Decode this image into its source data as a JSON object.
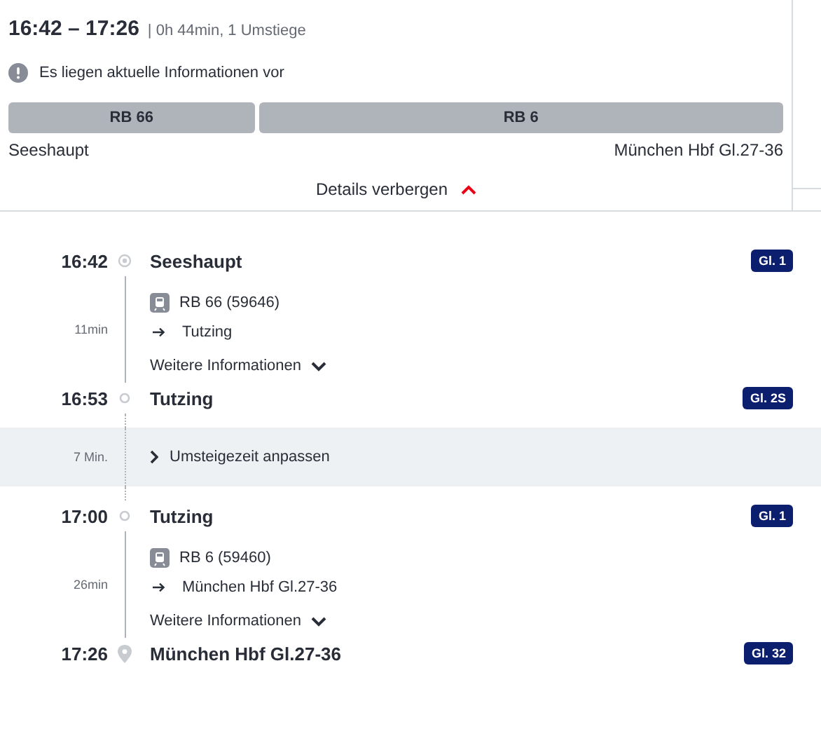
{
  "summary": {
    "times": "16:42 – 17:26",
    "meta": "| 0h 44min, 1 Umstiege",
    "notice": "Es liegen aktuelle Informationen vor",
    "segments": [
      {
        "label": "RB 66"
      },
      {
        "label": "RB 6"
      }
    ],
    "from": "Seeshaupt",
    "to": "München Hbf Gl.27-36",
    "toggle": "Details verbergen",
    "expanded": true
  },
  "timeline": [
    {
      "kind": "origin",
      "time": "16:42",
      "name": "Seeshaupt",
      "platform": "Gl. 1"
    },
    {
      "kind": "leg",
      "duration": "11min",
      "train": "RB 66 (59646)",
      "direction": "Tutzing",
      "more": "Weitere Informationen",
      "expanded": false
    },
    {
      "kind": "stop",
      "time": "16:53",
      "name": "Tutzing",
      "platform": "Gl. 2S"
    },
    {
      "kind": "transfer",
      "duration": "7 Min.",
      "label": "Umsteigezeit anpassen"
    },
    {
      "kind": "stop",
      "time": "17:00",
      "name": "Tutzing",
      "platform": "Gl. 1"
    },
    {
      "kind": "leg",
      "duration": "26min",
      "train": "RB 6 (59460)",
      "direction": "München Hbf Gl.27-36",
      "more": "Weitere Informationen",
      "expanded": false
    },
    {
      "kind": "arrival",
      "time": "17:26",
      "name": "München Hbf Gl.27-36",
      "platform": "Gl. 32"
    }
  ]
}
